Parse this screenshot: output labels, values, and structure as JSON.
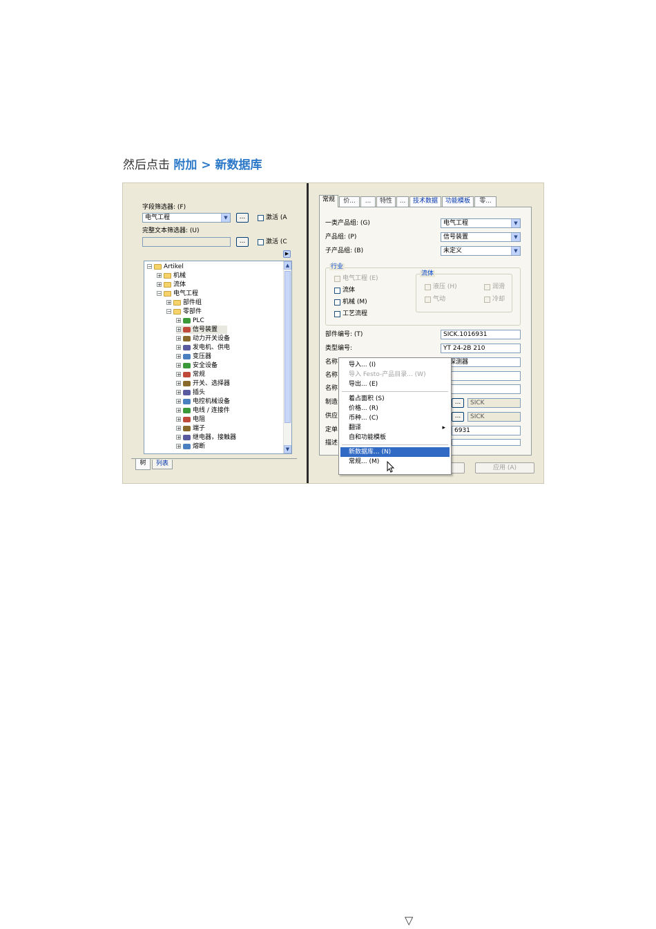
{
  "caption": {
    "prefix": "然后点击 ",
    "path": "附加 > 新数据库"
  },
  "left_panel": {
    "field_filter_label": "字段筛选器: (F)",
    "field_filter_value": "电气工程",
    "ellipsis": "...",
    "activate_label_1": "激活 (A",
    "fulltext_filter_label": "完整文本筛选器: (U)",
    "activate_label_2": "激活 (C",
    "tree": [
      {
        "label": "Artikel",
        "indent": 0,
        "pm": "⊟",
        "icon": "folder"
      },
      {
        "label": "机械",
        "indent": 1,
        "pm": "⊞",
        "icon": "folder"
      },
      {
        "label": "流体",
        "indent": 1,
        "pm": "⊞",
        "icon": "folder"
      },
      {
        "label": "电气工程",
        "indent": 1,
        "pm": "⊟",
        "icon": "folder"
      },
      {
        "label": "部件组",
        "indent": 2,
        "pm": "⊞",
        "icon": "folder"
      },
      {
        "label": "零部件",
        "indent": 2,
        "pm": "⊟",
        "icon": "folder"
      },
      {
        "label": "PLC",
        "indent": 3,
        "pm": "⊞",
        "icon": "device"
      },
      {
        "label": "信号装置",
        "indent": 3,
        "pm": "⊞",
        "icon": "device"
      },
      {
        "label": "动力开关设备",
        "indent": 3,
        "pm": "⊞",
        "icon": "device"
      },
      {
        "label": "发电机、供电",
        "indent": 3,
        "pm": "⊞",
        "icon": "device"
      },
      {
        "label": "变压器",
        "indent": 3,
        "pm": "⊞",
        "icon": "device"
      },
      {
        "label": "安全设备",
        "indent": 3,
        "pm": "⊞",
        "icon": "device"
      },
      {
        "label": "常规",
        "indent": 3,
        "pm": "⊞",
        "icon": "device"
      },
      {
        "label": "开关、选择器",
        "indent": 3,
        "pm": "⊞",
        "icon": "device"
      },
      {
        "label": "插头",
        "indent": 3,
        "pm": "⊞",
        "icon": "device"
      },
      {
        "label": "电控机械设备",
        "indent": 3,
        "pm": "⊞",
        "icon": "device"
      },
      {
        "label": "电线 / 连接件",
        "indent": 3,
        "pm": "⊞",
        "icon": "device"
      },
      {
        "label": "电阻",
        "indent": 3,
        "pm": "⊞",
        "icon": "device"
      },
      {
        "label": "端子",
        "indent": 3,
        "pm": "⊞",
        "icon": "device"
      },
      {
        "label": "继电器，接触器",
        "indent": 3,
        "pm": "⊞",
        "icon": "device"
      },
      {
        "label": "熔断",
        "indent": 3,
        "pm": "⊞",
        "icon": "device"
      }
    ],
    "bottom_tabs": [
      "树",
      "列表"
    ]
  },
  "right_panel": {
    "tabs": [
      "常规",
      "价...",
      "...",
      "特性",
      "...",
      "技术数据",
      "功能模板",
      "零..."
    ],
    "rows": [
      {
        "label": "一类产品组: (G)",
        "value": "电气工程"
      },
      {
        "label": "产品组: (P)",
        "value": "信号装置"
      },
      {
        "label": "子产品组: (B)",
        "value": "未定义"
      }
    ],
    "industry": {
      "title": "行业",
      "electrical": "电气工程 (E)",
      "fluid": "流体",
      "mechanical": "机械 (M)",
      "process": "工艺流程"
    },
    "fluid_group": {
      "title": "流体",
      "hydraulic": "液压 (H)",
      "lubrication": "润滑",
      "pneumatic": "气动",
      "cooling": "冷却"
    },
    "part_number_label": "部件编号: (T)",
    "part_number_value": "SICK.1016931",
    "type_number_label": "类型编号:",
    "type_number_value": "YT 24-2B 210",
    "name_label_1": "名称",
    "name_value_1": "射探测器",
    "name_label_2": "名称",
    "name_label_3": "名称",
    "manufacturer_label": "制造",
    "manufacturer_value": "SICK",
    "supplier_label": "供应",
    "supplier_value": "SICK",
    "order_label": "定单",
    "order_value": "6931",
    "desc_label": "描述",
    "apply_button": "应用 (A)"
  },
  "context_menu": {
    "items": [
      {
        "label": "导入... (I)",
        "state": "normal"
      },
      {
        "label": "导入 Festo-产品目录... (W)",
        "state": "disabled"
      },
      {
        "label": "导出... (E)",
        "state": "normal"
      },
      {
        "label": "-",
        "state": "sep"
      },
      {
        "label": "着占面积 (S)",
        "state": "normal"
      },
      {
        "label": "价格... (R)",
        "state": "normal"
      },
      {
        "label": "币种... (C)",
        "state": "normal"
      },
      {
        "label": "翻译",
        "state": "submenu"
      },
      {
        "label": "自和功能模板",
        "state": "normal"
      },
      {
        "label": "-",
        "state": "sep"
      },
      {
        "label": "新数据库... (N)",
        "state": "selected"
      },
      {
        "label": "常规... (M)",
        "state": "normal"
      }
    ]
  },
  "footer_glyph": "▽"
}
